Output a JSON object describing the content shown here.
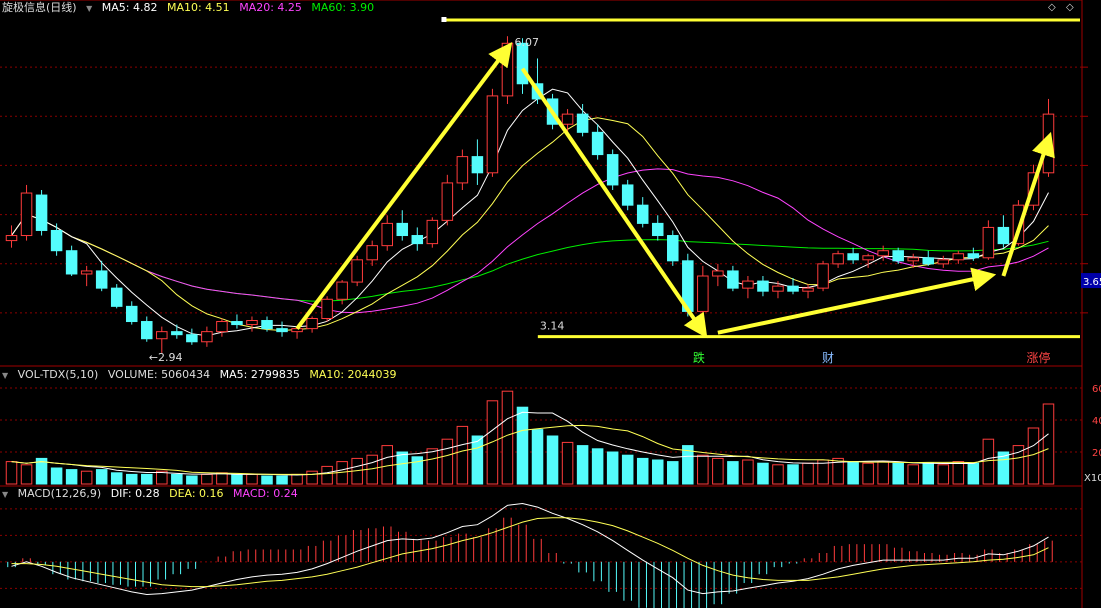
{
  "main_header": {
    "title": "旋极信息(日线)",
    "ma5": "MA5: 4.82",
    "ma10": "MA10: 4.51",
    "ma20": "MA20: 4.25",
    "ma60": "MA60: 3.90"
  },
  "vol_header": {
    "title": "VOL-TDX(5,10)",
    "volume": "VOLUME: 5060434",
    "ma5": "MA5: 2799835",
    "ma10": "MA10: 2044039"
  },
  "macd_header": {
    "title": "MACD(12,26,9)",
    "dif": "DIF: 0.28",
    "dea": "DEA: 0.16",
    "macd": "MACD: 0.24"
  },
  "annotations": {
    "high_label": "6.07",
    "low_label": "2.94",
    "support_label": "3.14",
    "current_price_tag": "3.65",
    "event_die": "跌",
    "event_cai": "财",
    "event_zhangting": "涨停",
    "vol_ticks": [
      "60",
      "40",
      "20"
    ],
    "vol_unit": "X10"
  },
  "colors": {
    "up": "#ff3c3c",
    "down": "#54fcfc",
    "ma5": "#ffffff",
    "ma10": "#ffff55",
    "ma20": "#ff44ff",
    "ma60": "#00ee00",
    "arrow": "#ffff33",
    "grid": "#8b0000"
  },
  "chart_data": {
    "type": "candlestick",
    "price_range": [
      2.85,
      6.25
    ],
    "candles_ohlc": [
      [
        4.05,
        4.2,
        3.98,
        4.1
      ],
      [
        4.1,
        4.6,
        4.05,
        4.52
      ],
      [
        4.5,
        4.55,
        4.1,
        4.15
      ],
      [
        4.15,
        4.22,
        3.9,
        3.95
      ],
      [
        3.95,
        4.0,
        3.7,
        3.72
      ],
      [
        3.72,
        3.8,
        3.6,
        3.75
      ],
      [
        3.75,
        3.85,
        3.55,
        3.58
      ],
      [
        3.58,
        3.62,
        3.38,
        3.4
      ],
      [
        3.4,
        3.45,
        3.22,
        3.25
      ],
      [
        3.25,
        3.3,
        3.05,
        3.08
      ],
      [
        3.08,
        3.2,
        2.94,
        3.15
      ],
      [
        3.15,
        3.22,
        3.08,
        3.12
      ],
      [
        3.12,
        3.18,
        3.02,
        3.05
      ],
      [
        3.05,
        3.2,
        3.0,
        3.15
      ],
      [
        3.15,
        3.28,
        3.1,
        3.25
      ],
      [
        3.25,
        3.32,
        3.18,
        3.22
      ],
      [
        3.22,
        3.3,
        3.15,
        3.26
      ],
      [
        3.26,
        3.3,
        3.15,
        3.18
      ],
      [
        3.18,
        3.25,
        3.1,
        3.15
      ],
      [
        3.15,
        3.2,
        3.08,
        3.18
      ],
      [
        3.18,
        3.3,
        3.14,
        3.28
      ],
      [
        3.28,
        3.5,
        3.25,
        3.47
      ],
      [
        3.47,
        3.66,
        3.42,
        3.64
      ],
      [
        3.64,
        3.9,
        3.6,
        3.86
      ],
      [
        3.86,
        4.05,
        3.8,
        4.0
      ],
      [
        4.0,
        4.3,
        3.95,
        4.22
      ],
      [
        4.22,
        4.35,
        4.05,
        4.1
      ],
      [
        4.1,
        4.18,
        3.95,
        4.02
      ],
      [
        4.02,
        4.28,
        3.98,
        4.25
      ],
      [
        4.25,
        4.7,
        4.2,
        4.62
      ],
      [
        4.62,
        4.95,
        4.55,
        4.88
      ],
      [
        4.88,
        5.05,
        4.6,
        4.72
      ],
      [
        4.72,
        5.55,
        4.68,
        5.48
      ],
      [
        5.48,
        6.07,
        5.4,
        6.0
      ],
      [
        6.0,
        6.05,
        5.5,
        5.6
      ],
      [
        5.6,
        5.85,
        5.4,
        5.45
      ],
      [
        5.45,
        5.5,
        5.15,
        5.2
      ],
      [
        5.2,
        5.35,
        5.1,
        5.3
      ],
      [
        5.3,
        5.4,
        5.08,
        5.12
      ],
      [
        5.12,
        5.2,
        4.85,
        4.9
      ],
      [
        4.9,
        4.95,
        4.55,
        4.6
      ],
      [
        4.6,
        4.65,
        4.35,
        4.4
      ],
      [
        4.4,
        4.48,
        4.18,
        4.22
      ],
      [
        4.22,
        4.3,
        4.05,
        4.1
      ],
      [
        4.1,
        4.15,
        3.8,
        3.85
      ],
      [
        3.85,
        3.92,
        3.3,
        3.35
      ],
      [
        3.35,
        3.8,
        3.14,
        3.7
      ],
      [
        3.7,
        3.82,
        3.6,
        3.75
      ],
      [
        3.75,
        3.8,
        3.55,
        3.58
      ],
      [
        3.58,
        3.7,
        3.48,
        3.65
      ],
      [
        3.65,
        3.7,
        3.5,
        3.55
      ],
      [
        3.55,
        3.65,
        3.48,
        3.6
      ],
      [
        3.6,
        3.68,
        3.52,
        3.55
      ],
      [
        3.55,
        3.62,
        3.48,
        3.58
      ],
      [
        3.58,
        3.85,
        3.55,
        3.82
      ],
      [
        3.82,
        3.95,
        3.78,
        3.92
      ],
      [
        3.92,
        3.98,
        3.82,
        3.86
      ],
      [
        3.86,
        3.92,
        3.78,
        3.9
      ],
      [
        3.9,
        4.0,
        3.85,
        3.95
      ],
      [
        3.95,
        3.98,
        3.82,
        3.85
      ],
      [
        3.85,
        3.92,
        3.78,
        3.88
      ],
      [
        3.88,
        3.95,
        3.8,
        3.82
      ],
      [
        3.82,
        3.9,
        3.78,
        3.86
      ],
      [
        3.86,
        3.95,
        3.82,
        3.92
      ],
      [
        3.92,
        3.98,
        3.85,
        3.88
      ],
      [
        3.88,
        4.25,
        3.86,
        4.18
      ],
      [
        4.18,
        4.3,
        3.98,
        4.02
      ],
      [
        4.02,
        4.45,
        4.0,
        4.4
      ],
      [
        4.4,
        4.8,
        4.35,
        4.72
      ],
      [
        4.72,
        5.45,
        4.68,
        5.3
      ]
    ],
    "volume_scale": [
      0,
      65
    ],
    "volumes": [
      14,
      12,
      16,
      10,
      9,
      8,
      9,
      7,
      6,
      6,
      8,
      6,
      5,
      6,
      7,
      6,
      6,
      5,
      5,
      6,
      8,
      11,
      14,
      16,
      18,
      24,
      20,
      17,
      22,
      28,
      36,
      30,
      52,
      58,
      48,
      34,
      30,
      26,
      24,
      22,
      20,
      18,
      16,
      15,
      14,
      24,
      18,
      16,
      14,
      15,
      13,
      12,
      12,
      13,
      15,
      16,
      14,
      13,
      14,
      13,
      12,
      13,
      12,
      14,
      13,
      28,
      20,
      24,
      35,
      50
    ],
    "macd_range": [
      -0.5,
      0.7
    ],
    "macd": {
      "dif": [
        -0.05,
        0.0,
        -0.05,
        -0.12,
        -0.18,
        -0.22,
        -0.26,
        -0.3,
        -0.34,
        -0.37,
        -0.36,
        -0.34,
        -0.32,
        -0.28,
        -0.24,
        -0.2,
        -0.17,
        -0.15,
        -0.14,
        -0.12,
        -0.08,
        -0.02,
        0.05,
        0.12,
        0.18,
        0.24,
        0.26,
        0.25,
        0.27,
        0.33,
        0.4,
        0.42,
        0.52,
        0.64,
        0.66,
        0.62,
        0.55,
        0.49,
        0.42,
        0.34,
        0.24,
        0.13,
        0.02,
        -0.08,
        -0.18,
        -0.32,
        -0.36,
        -0.34,
        -0.33,
        -0.3,
        -0.27,
        -0.24,
        -0.22,
        -0.19,
        -0.14,
        -0.08,
        -0.04,
        -0.01,
        0.02,
        0.02,
        0.02,
        0.02,
        0.02,
        0.04,
        0.04,
        0.09,
        0.08,
        0.12,
        0.18,
        0.28
      ],
      "dea": [
        -0.02,
        -0.02,
        -0.03,
        -0.05,
        -0.08,
        -0.11,
        -0.14,
        -0.17,
        -0.2,
        -0.23,
        -0.26,
        -0.27,
        -0.28,
        -0.28,
        -0.27,
        -0.26,
        -0.24,
        -0.22,
        -0.21,
        -0.19,
        -0.17,
        -0.14,
        -0.1,
        -0.06,
        -0.01,
        0.04,
        0.09,
        0.12,
        0.15,
        0.19,
        0.24,
        0.28,
        0.33,
        0.39,
        0.45,
        0.49,
        0.5,
        0.5,
        0.48,
        0.45,
        0.41,
        0.35,
        0.28,
        0.21,
        0.13,
        0.04,
        -0.04,
        -0.1,
        -0.15,
        -0.18,
        -0.2,
        -0.21,
        -0.21,
        -0.21,
        -0.19,
        -0.17,
        -0.14,
        -0.11,
        -0.08,
        -0.06,
        -0.04,
        -0.03,
        -0.02,
        -0.01,
        0.0,
        0.02,
        0.03,
        0.05,
        0.08,
        0.16
      ]
    }
  }
}
